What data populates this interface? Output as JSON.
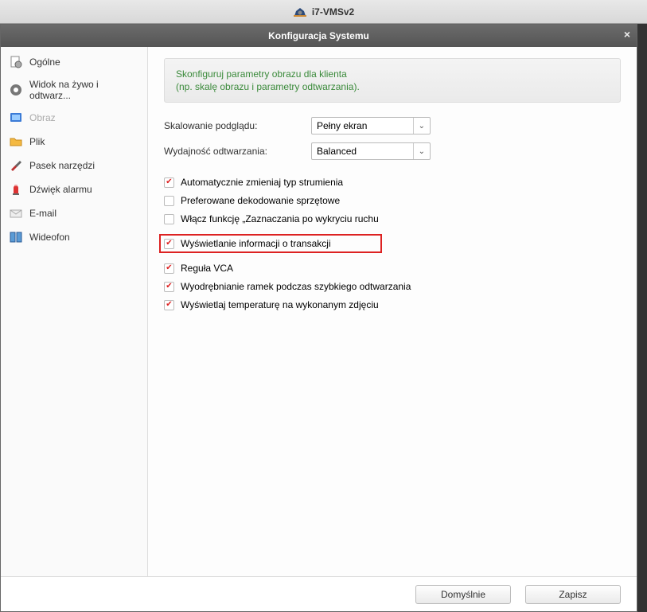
{
  "app": {
    "title": "i7-VMSv2"
  },
  "dialog": {
    "title": "Konfiguracja Systemu",
    "close": "×"
  },
  "sidebar": {
    "items": [
      {
        "label": "Ogólne"
      },
      {
        "label": "Widok na żywo i odtwarz..."
      },
      {
        "label": "Obraz"
      },
      {
        "label": "Plik"
      },
      {
        "label": "Pasek narzędzi"
      },
      {
        "label": "Dźwięk alarmu"
      },
      {
        "label": "E-mail"
      },
      {
        "label": "Wideofon"
      }
    ]
  },
  "hint": {
    "line1": "Skonfiguruj parametry obrazu dla klienta",
    "line2": "(np. skalę obrazu i parametry odtwarzania)."
  },
  "form": {
    "scaling_label": "Skalowanie podglądu:",
    "scaling_value": "Pełny ekran",
    "playback_label": "Wydajność odtwarzania:",
    "playback_value": "Balanced"
  },
  "checks": {
    "c0": "Automatycznie zmieniaj typ strumienia",
    "c1": "Preferowane dekodowanie sprzętowe",
    "c2": "Włącz funkcję „Zaznaczania po wykryciu ruchu",
    "c3": "Wyświetlanie informacji o transakcji",
    "c4": "Reguła VCA",
    "c5": "Wyodrębnianie ramek podczas szybkiego odtwarzania",
    "c6": "Wyświetlaj temperaturę na wykonanym zdjęciu"
  },
  "buttons": {
    "default": "Domyślnie",
    "save": "Zapisz"
  }
}
